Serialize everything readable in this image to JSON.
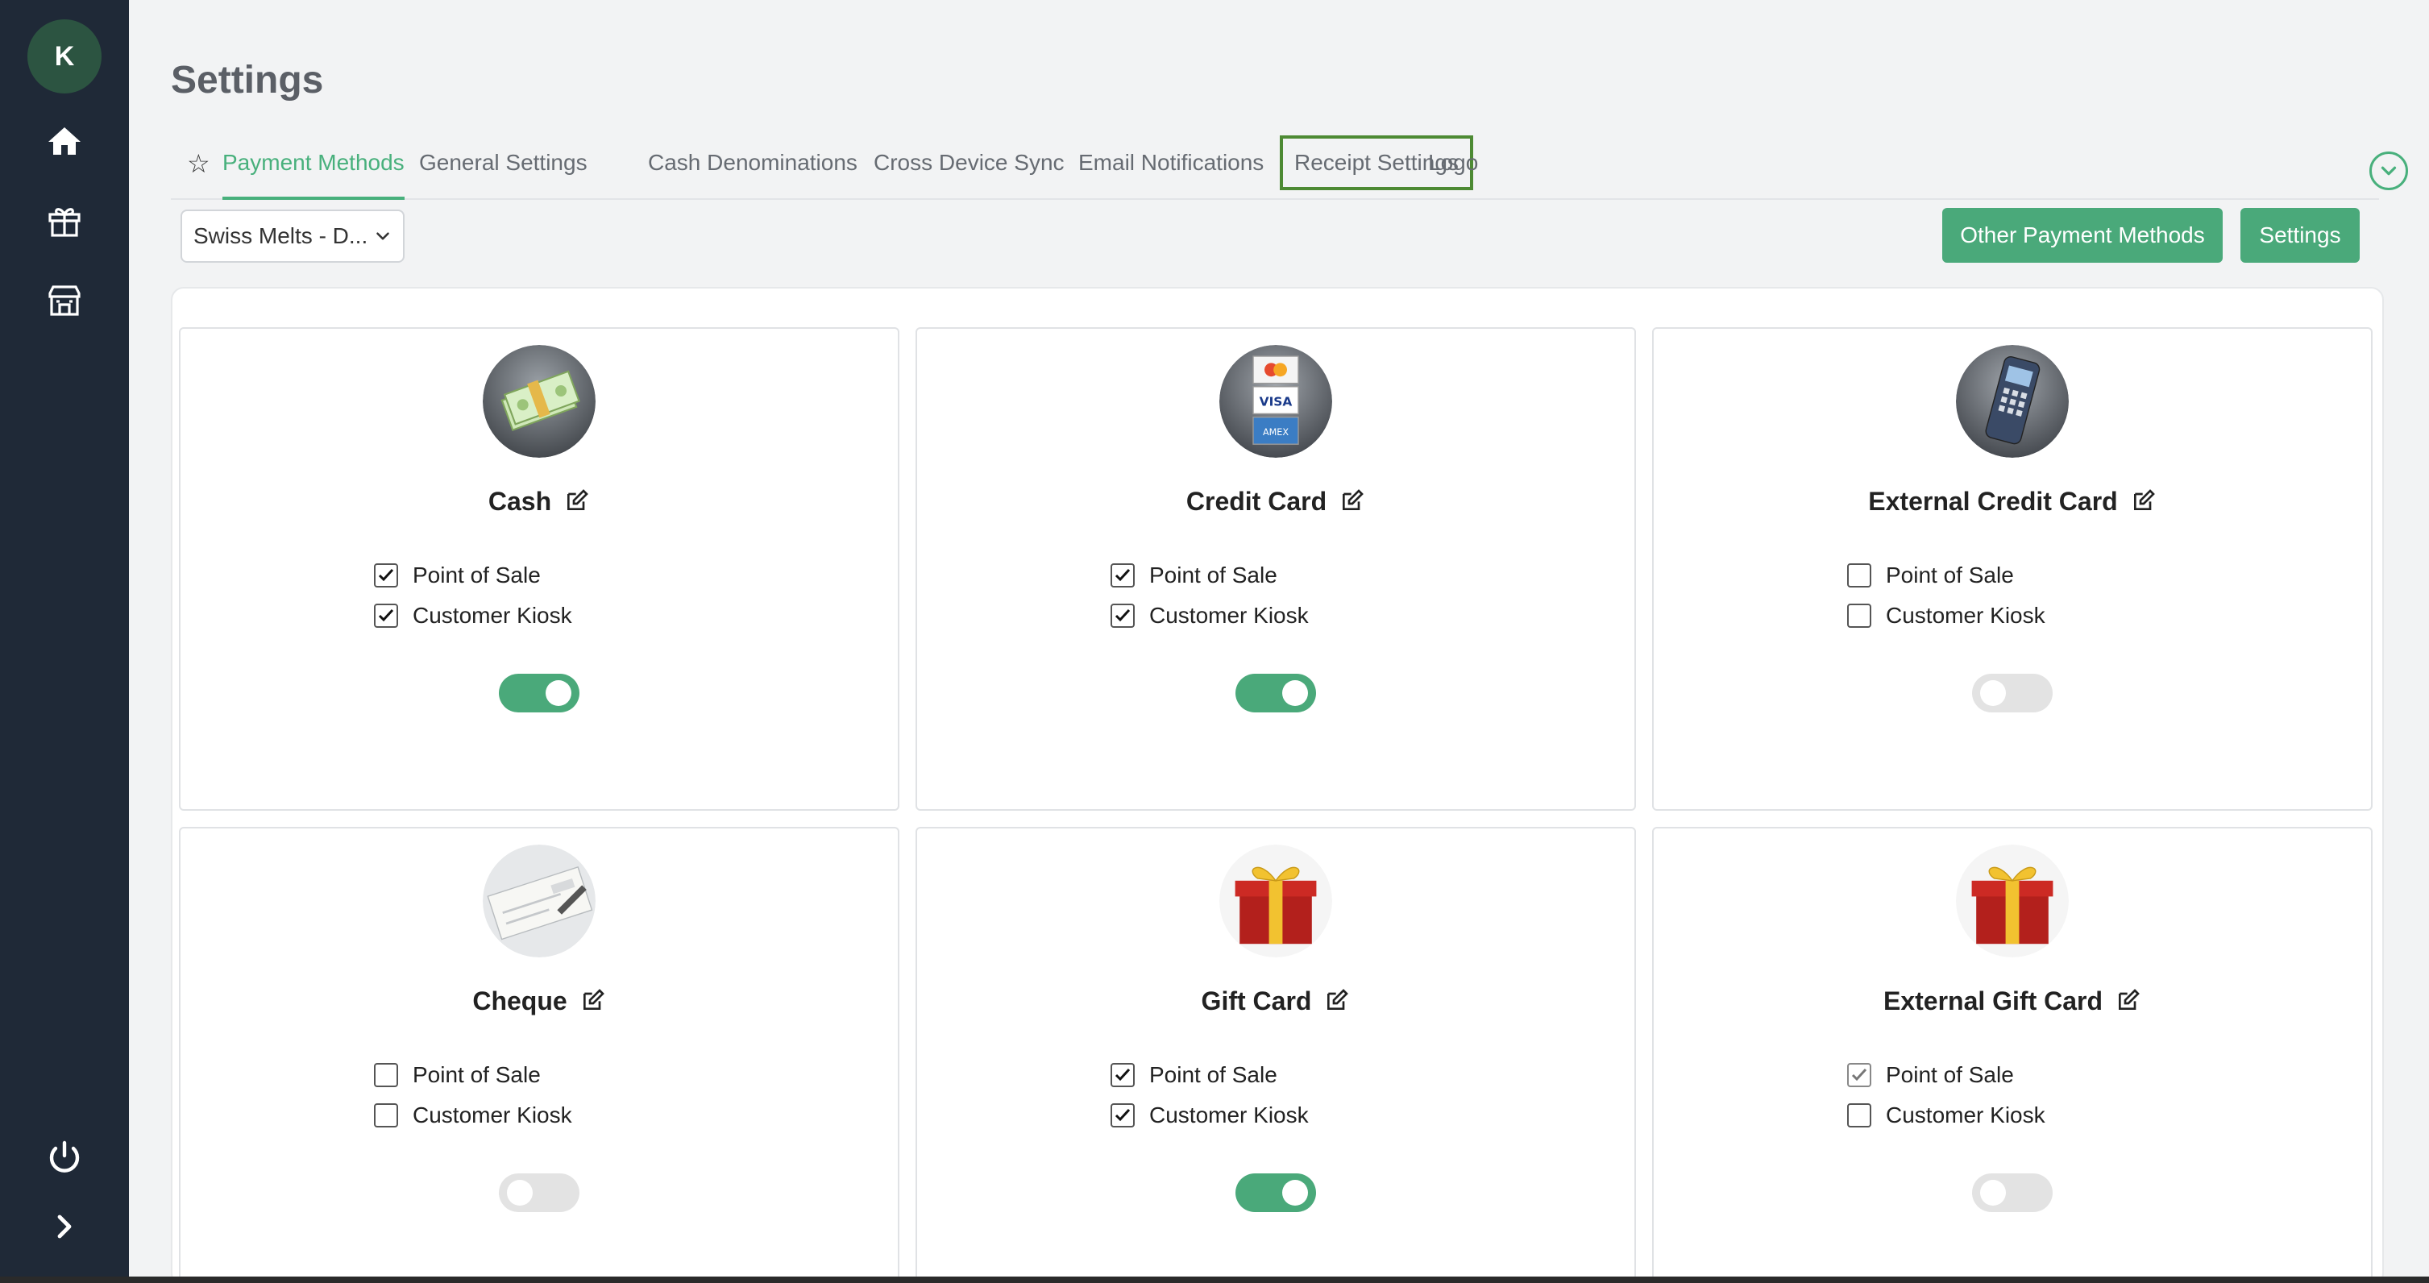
{
  "sidebar": {
    "avatar_initial": "K",
    "items": [
      {
        "icon": "home-icon"
      },
      {
        "icon": "gift-icon"
      },
      {
        "icon": "store-icon"
      }
    ],
    "bottom": [
      {
        "icon": "power-icon"
      },
      {
        "icon": "chevron-right-icon"
      }
    ]
  },
  "page": {
    "title": "Settings"
  },
  "tabs": [
    {
      "label": "Payment Methods",
      "active": true
    },
    {
      "label": "General Settings"
    },
    {
      "label": "Cash Denominations"
    },
    {
      "label": "Cross Device Sync"
    },
    {
      "label": "Email Notifications"
    },
    {
      "label": "Receipt Settings",
      "focused": true
    },
    {
      "label": "Logo"
    }
  ],
  "toolbar": {
    "location_value": "Swiss Melts - D...",
    "other_methods_label": "Other Payment Methods",
    "settings_label": "Settings"
  },
  "options": {
    "pos_label": "Point of Sale",
    "kiosk_label": "Customer Kiosk"
  },
  "cards": [
    {
      "name": "Cash",
      "icon": "cash-icon",
      "pos": true,
      "kiosk": true,
      "enabled": true
    },
    {
      "name": "Credit Card",
      "icon": "credit-cards-icon",
      "pos": true,
      "kiosk": true,
      "enabled": true
    },
    {
      "name": "External Credit Card",
      "icon": "card-terminal-icon",
      "pos": false,
      "kiosk": false,
      "enabled": false
    },
    {
      "name": "Cheque",
      "icon": "cheque-icon",
      "pos": false,
      "kiosk": false,
      "enabled": false
    },
    {
      "name": "Gift Card",
      "icon": "gift-box-icon",
      "pos": true,
      "kiosk": true,
      "enabled": true
    },
    {
      "name": "External Gift Card",
      "icon": "gift-box-icon",
      "pos": true,
      "kiosk": false,
      "enabled": false
    }
  ],
  "colors": {
    "accent": "#48b07c",
    "button": "#4aa97a",
    "sidebar": "#1f2937",
    "focus_outline": "#4d8a33"
  }
}
